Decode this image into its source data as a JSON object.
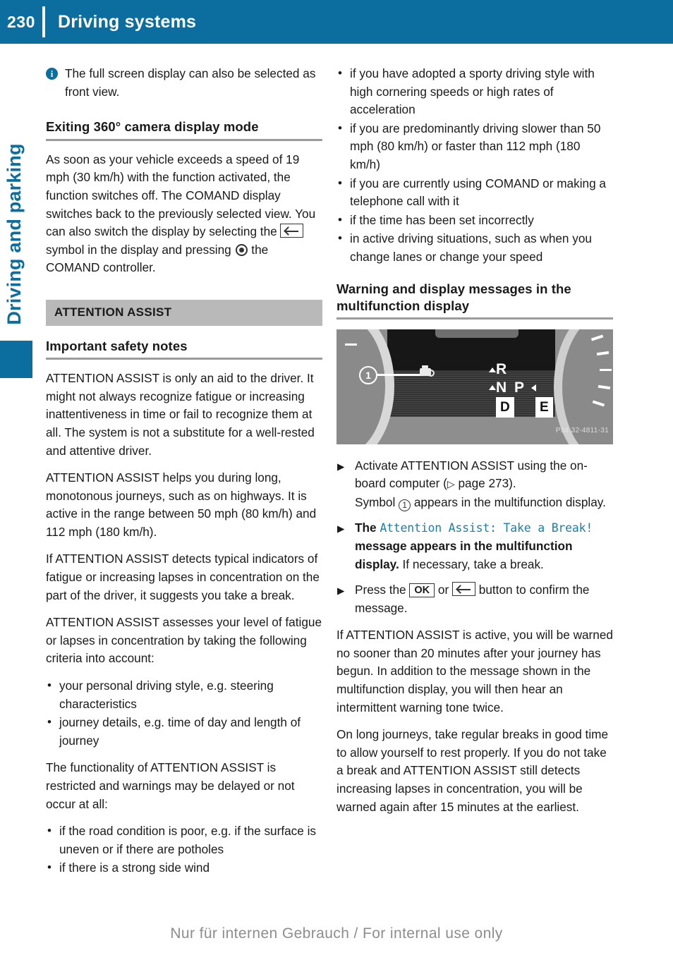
{
  "header": {
    "page_number": "230",
    "title": "Driving systems",
    "bg_color": "#0b6e9e"
  },
  "side_tab": {
    "label": "Driving and parking",
    "color": "#0b6e9e"
  },
  "left_column": {
    "info_note": {
      "icon": "info-icon",
      "text": "The full screen display can also be selected as front view."
    },
    "heading_exiting": "Exiting 360° camera display mode",
    "para_exiting_1": "As soon as your vehicle exceeds a speed of 19 mph (30 km/h) with the function activated, the function switches off. The COMAND display switches back to the previously selected view. You can also switch the display by selecting the",
    "para_exiting_2": "symbol in the display and pressing",
    "para_exiting_3": "the COMAND controller.",
    "section_bar": "ATTENTION ASSIST",
    "heading_safety": "Important safety notes",
    "para_safety_1": "ATTENTION ASSIST is only an aid to the driver. It might not always recognize fatigue or increasing inattentiveness in time or fail to recognize them at all. The system is not a substitute for a well-rested and attentive driver.",
    "para_safety_2": "ATTENTION ASSIST helps you during long, monotonous journeys, such as on highways. It is active in the range between 50 mph (80 km/h) and 112 mph (180 km/h).",
    "para_safety_3": "If ATTENTION ASSIST detects typical indicators of fatigue or increasing lapses in concentration on the part of the driver, it suggests you take a break.",
    "para_safety_4": "ATTENTION ASSIST assesses your level of fatigue or lapses in concentration by taking the following criteria into account:",
    "criteria_bullets": [
      "your personal driving style, e.g. steering characteristics",
      "journey details, e.g. time of day and length of journey"
    ],
    "para_restricted": "The functionality of ATTENTION ASSIST is restricted and warnings may be delayed or not occur at all:",
    "restriction_bullets": [
      "if the road condition is poor, e.g. if the surface is uneven or if there are potholes",
      "if there is a strong side wind"
    ]
  },
  "right_column": {
    "restriction_bullets_cont": [
      "if you have adopted a sporty driving style with high cornering speeds or high rates of acceleration",
      "if you are predominantly driving slower than 50 mph (80 km/h) or faster than 112 mph (180 km/h)",
      "if you are currently using COMAND or making a telephone call with it",
      "if the time has been set incorrectly",
      "in active driving situations, such as when you change lanes or change your speed"
    ],
    "heading_warning": "Warning and display messages in the multifunction display",
    "figure": {
      "caption_code": "P54.32-4811-31",
      "callout_number": "1",
      "gear_letters": [
        "R",
        "N",
        "P",
        "D",
        "E"
      ],
      "icon": "coffee-cup-icon"
    },
    "steps": {
      "step1_part1": "Activate ATTENTION ASSIST using the on-board computer (",
      "step1_xref_arrow": "▷",
      "step1_xref": " page 273).",
      "step1_part2": "Symbol",
      "step1_symbol": "1",
      "step1_part3": "appears in the multifunction display.",
      "step2_lead": "The",
      "step2_message": "Attention Assist: Take a Break!",
      "step2_bold": "message appears in the multifunction display.",
      "step2_rest": "If necessary, take a break.",
      "step3_part1": "Press the",
      "step3_key_ok": "OK",
      "step3_or": "or",
      "step3_key_back": "back-button-icon",
      "step3_part2": "button to confirm the message."
    },
    "para_active": "If ATTENTION ASSIST is active, you will be warned no sooner than 20 minutes after your journey has begun. In addition to the message shown in the multifunction display, you will then hear an intermittent warning tone twice.",
    "para_longjourneys": "On long journeys, take regular breaks in good time to allow yourself to rest properly. If you do not take a break and ATTENTION ASSIST still detects increasing lapses in concentration, you will be warned again after 15 minutes at the earliest."
  },
  "footer": {
    "text": "Nur für internen Gebrauch / For internal use only"
  }
}
